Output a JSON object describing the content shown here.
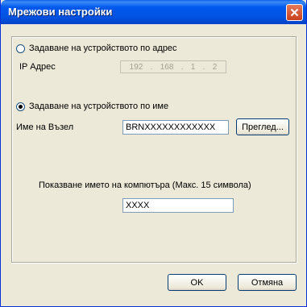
{
  "window": {
    "title": "Мрежови настройки"
  },
  "option_address": {
    "label": "Задаване на устройството по адрес",
    "checked": false
  },
  "ip": {
    "label": "IP Адрес",
    "octets": [
      "192",
      "168",
      "1",
      "2"
    ]
  },
  "option_name": {
    "label": "Задаване на устройството по име",
    "checked": true
  },
  "node": {
    "label": "Име на Възел",
    "value": "BRNXXXXXXXXXXXX",
    "browse_label": "Преглед..."
  },
  "pc_name": {
    "label": "Показване името на компютъра (Макс. 15 символа)",
    "value": "XXXX"
  },
  "buttons": {
    "ok": "OK",
    "cancel": "Отмяна"
  },
  "colors": {
    "title_bar": "#0054e3",
    "close_button": "#c9401e",
    "dialog_bg": "#ece9d8"
  }
}
